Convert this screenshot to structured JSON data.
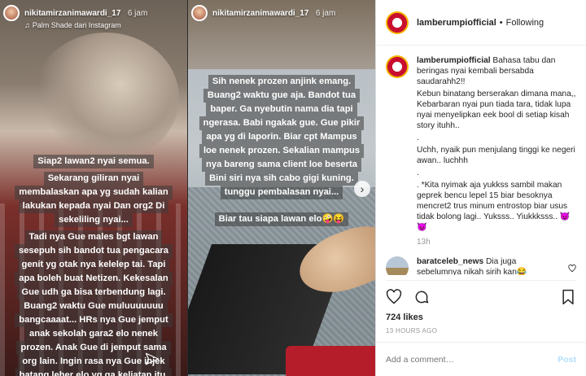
{
  "story1": {
    "username": "nikitamirzanimawardi_17",
    "time": "6 jam",
    "music_label": "Palm Shade dari Instagram",
    "caption_lines": [
      "Siap2 lawan2 nyai semua.",
      "Sekarang giliran nyai",
      "membalaskan apa yg sudah kalian",
      "lakukan kepada nyai Dan org2 Di",
      "sekeliling nyai...",
      "Tadi nya Gue males bgt lawan",
      "sesepuh sih bandot tua pengacara",
      "genit yg otak nya kelelep tai. Tapi",
      "apa boleh buat Netizen. Kekesalan",
      "Gue udh ga bisa terbendung lagi.",
      "Buang2 waktu Gue muluuuuuuu",
      "bangcaaaat... HRs nya Gue jemput",
      "anak sekolah gara2 elo nenek",
      "prozen. Anak Gue di jemput sama",
      "org lain. Ingin rasa nya Gue injek",
      "batang leher elo yg ga keliatan itu."
    ]
  },
  "story2": {
    "username": "nikitamirzanimawardi_17",
    "time": "6 jam",
    "caption_lines": [
      "Sih nenek prozen anjink emang.",
      "Buang2 waktu gue aja. Bandot tua",
      "baper. Ga nyebutin nama dia tapi",
      "ngerasa. Babi ngakak gue. Gue pikir",
      "apa yg di laporin. Biar cpt Mampus",
      "loe nenek prozen.  Sekalian mampus",
      "nya bareng sama client loe beserta",
      "Bini siri nya sih cabo gigi kuning.",
      "tunggu pembalasan nyai..."
    ],
    "caption2": "Biar tau siapa lawan elo🤪😝"
  },
  "post": {
    "username": "lamberumpiofficial",
    "separator": "•",
    "follow_status": "Following",
    "caption_user": "lamberumpiofficial",
    "caption_paras": [
      "Bahasa tabu dan beringas nyai kembali bersabda saudarahh2!!",
      "Kebun binatang berserakan dimana mana,, Kebarbaran nyai pun tiada tara, tidak lupa nyai menyelipkan eek bool di setiap kisah story ituhh..",
      ".",
      "Uchh, nyaik pun menjulang tinggi ke negeri awan.. luchhh",
      ".",
      ". *Kita nyimak aja yukkss sambil makan geprek bencu lepel 15 biar besoknya mencret2 trus minum entrostop biar usus tidak bolong lagi.. Yuksss.. Yiukkksss.. 😈😈"
    ],
    "caption_time": "13h",
    "comment_user": "baratceleb_news",
    "comment_text": "Dia juga sebelumnya nikah sirih kan😂",
    "likes": "724 likes",
    "post_time": "13 HOURS AGO",
    "add_comment_placeholder": "Add a comment…",
    "post_button": "Post"
  },
  "colors": {
    "link_blue_disabled": "#b2dffc",
    "text_dark": "#262626",
    "text_muted": "#999999"
  },
  "icons": [
    "music-note-icon",
    "send-icon",
    "chevron-right-icon",
    "heart-icon",
    "comment-icon",
    "share-icon",
    "bookmark-icon"
  ]
}
